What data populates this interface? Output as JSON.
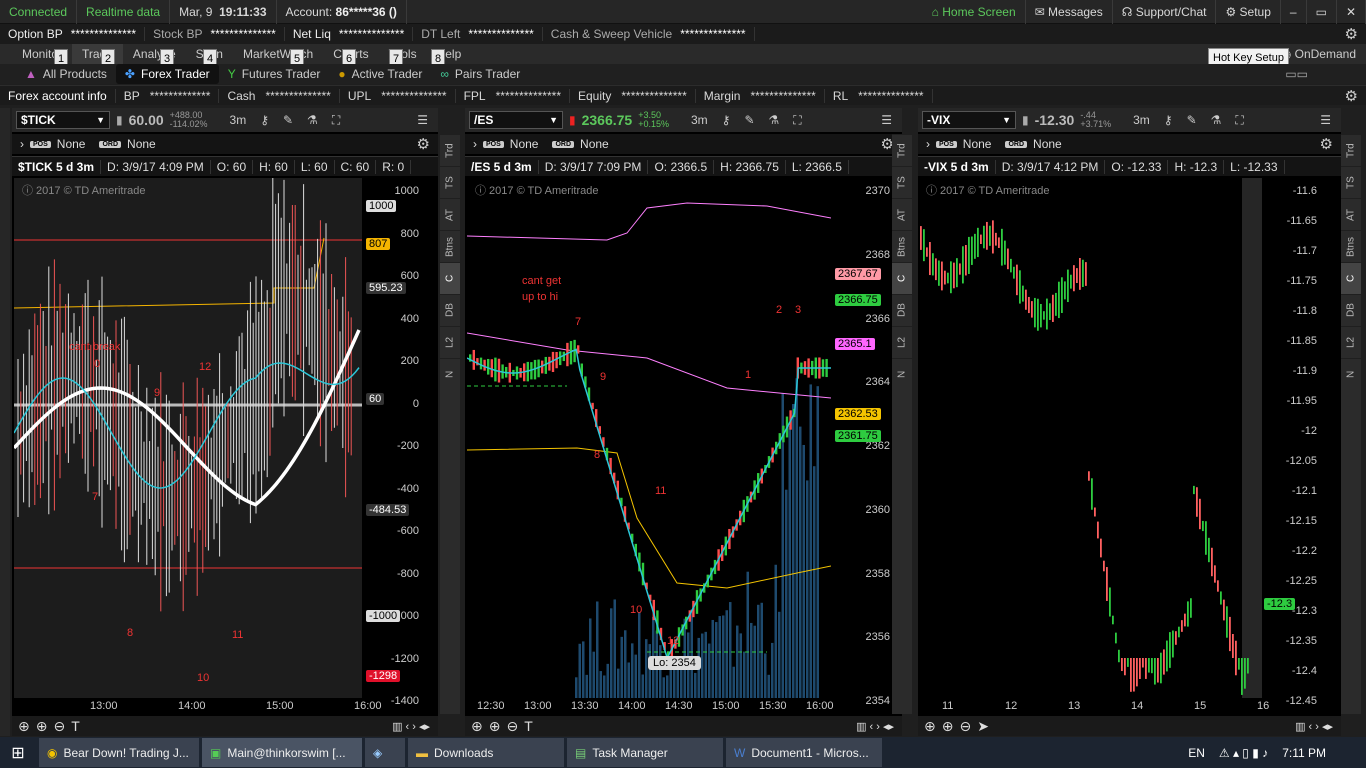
{
  "status": {
    "connected": "Connected",
    "realtime": "Realtime data",
    "date": "Mar, 9",
    "time": "19:11:33",
    "account_label": "Account:",
    "account_value": "86*****36 ()",
    "home": "Home Screen",
    "messages": "Messages",
    "support": "Support/Chat",
    "setup": "Setup"
  },
  "account_bar": [
    {
      "label": "Option BP",
      "value": "**************"
    },
    {
      "label": "Stock BP",
      "value": "**************"
    },
    {
      "label": "Net Liq",
      "value": "**************"
    },
    {
      "label": "DT Left",
      "value": "**************"
    },
    {
      "label": "Cash & Sweep Vehicle",
      "value": "**************"
    }
  ],
  "tabs": [
    "Monitor",
    "Trade",
    "Analyze",
    "Scan",
    "MarketWatch",
    "Charts",
    "Tools",
    "Help"
  ],
  "tab_right": {
    "in": "In",
    "ondemand": "OnDemand"
  },
  "hotkeys": [
    "1",
    "2",
    "3",
    "4",
    "5",
    "6",
    "7",
    "8"
  ],
  "tooltip": "Hot Key Setup",
  "subtabs": [
    "All Products",
    "Forex Trader",
    "Futures Trader",
    "Active Trader",
    "Pairs Trader"
  ],
  "fx_bar": {
    "title": "Forex account info",
    "items": [
      {
        "label": "BP",
        "value": "*************"
      },
      {
        "label": "Cash",
        "value": "**************"
      },
      {
        "label": "UPL",
        "value": "**************"
      },
      {
        "label": "FPL",
        "value": "**************"
      },
      {
        "label": "Equity",
        "value": "**************"
      },
      {
        "label": "Margin",
        "value": "**************"
      },
      {
        "label": "RL",
        "value": "**************"
      }
    ]
  },
  "colors": {
    "up": "#5cc85c",
    "down": "#ff5a5a",
    "accent": "#4aa0ff"
  },
  "vtabs": [
    "Trd",
    "TS",
    "AT",
    "Btns",
    "C",
    "DB",
    "L2",
    "N"
  ],
  "panels": [
    {
      "symbol": "$TICK",
      "price": "60.00",
      "chg1": "+488.00",
      "chg2": "-114.02%",
      "agg": "3m",
      "pos": "None",
      "ord": "None",
      "header": {
        "title": "$TICK 5 d 3m",
        "d": "D: 3/9/17 4:09 PM",
        "o": "O: 60",
        "h": "H: 60",
        "l": "L: 60",
        "c": "C: 60",
        "r": "R: 0"
      },
      "copyright": "2017 © TD Ameritrade",
      "yticks": [
        "1000",
        "800",
        "600",
        "400",
        "200",
        "0",
        "-200",
        "-400",
        "-600",
        "-800",
        "-1000",
        "-1200",
        "-1400"
      ],
      "tags": [
        {
          "text": "1000",
          "bg": "#ddd",
          "fg": "#000"
        },
        {
          "text": "807",
          "bg": "#f4b400",
          "fg": "#000"
        },
        {
          "text": "595.23",
          "bg": "#333",
          "fg": "#fff"
        },
        {
          "text": "60",
          "bg": "#333",
          "fg": "#fff"
        },
        {
          "text": "-484.53",
          "bg": "#333",
          "fg": "#fff"
        },
        {
          "text": "-1000",
          "bg": "#ddd",
          "fg": "#000"
        },
        {
          "text": "-1298",
          "bg": "#e0102a",
          "fg": "#fff"
        }
      ],
      "xticks": [
        "13:00",
        "14:00",
        "15:00",
        "16:00"
      ],
      "annotations": [
        "cant break",
        "0",
        "9",
        "12",
        "7",
        "8",
        "10",
        "11"
      ]
    },
    {
      "symbol": "/ES",
      "price": "2366.75",
      "chg1": "+3.50",
      "chg2": "+0.15%",
      "agg": "3m",
      "pos": "None",
      "ord": "None",
      "header": {
        "title": "/ES 5 d 3m",
        "d": "D: 3/9/17 7:09 PM",
        "o": "O: 2366.5",
        "h": "H: 2366.75",
        "l": "L: 2366.5"
      },
      "copyright": "2017 © TD Ameritrade",
      "yticks": [
        "2370",
        "2368",
        "2366",
        "2364",
        "2362",
        "2360",
        "2358",
        "2356",
        "2354"
      ],
      "tags": [
        {
          "text": "2367.67",
          "bg": "#ff9aa6",
          "fg": "#000"
        },
        {
          "text": "2366.75",
          "bg": "#2ecc40",
          "fg": "#000"
        },
        {
          "text": "2365.1",
          "bg": "#ff66ff",
          "fg": "#000"
        },
        {
          "text": "2362.53",
          "bg": "#f4c400",
          "fg": "#000"
        },
        {
          "text": "2361.75",
          "bg": "#2ecc40",
          "fg": "#000"
        }
      ],
      "xticks": [
        "12:30",
        "13:00",
        "13:30",
        "14:00",
        "14:30",
        "15:00",
        "15:30",
        "16:00"
      ],
      "annotations": [
        "cant get",
        "up to hi",
        "7",
        "9",
        "8",
        "11",
        "10",
        "12",
        "1",
        "2",
        "3"
      ],
      "low": "Lo: 2354"
    },
    {
      "symbol": "-VIX",
      "price": "-12.30",
      "chg1": "-.44",
      "chg2": "+3.71%",
      "agg": "3m",
      "pos": "None",
      "ord": "None",
      "header": {
        "title": "-VIX 5 d 3m",
        "d": "D: 3/9/17 4:12 PM",
        "o": "O: -12.33",
        "h": "H: -12.3",
        "l": "L: -12.33"
      },
      "copyright": "2017 © TD Ameritrade",
      "yticks": [
        "-11.6",
        "-11.65",
        "-11.7",
        "-11.75",
        "-11.8",
        "-11.85",
        "-11.9",
        "-11.95",
        "-12",
        "-12.05",
        "-12.1",
        "-12.15",
        "-12.2",
        "-12.25",
        "-12.3",
        "-12.35",
        "-12.4",
        "-12.45"
      ],
      "tags": [
        {
          "text": "-12.3",
          "bg": "#2ecc40",
          "fg": "#000"
        }
      ],
      "xticks": [
        "11",
        "12",
        "13",
        "14",
        "15",
        "16"
      ]
    }
  ],
  "taskbar": {
    "items": [
      "Bear Down! Trading J...",
      "Main@thinkorswim [...",
      "",
      "Downloads",
      "Task Manager",
      "Document1 - Micros..."
    ],
    "lang": "EN",
    "clock": "7:11 PM"
  }
}
